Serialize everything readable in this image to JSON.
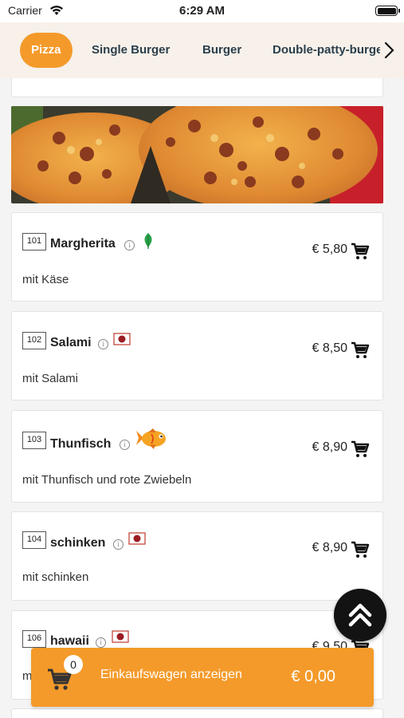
{
  "status_bar": {
    "carrier": "Carrier",
    "time": "6:29 AM"
  },
  "categories": [
    {
      "label": "Pizza",
      "active": true
    },
    {
      "label": "Single Burger",
      "active": false
    },
    {
      "label": "Burger",
      "active": false
    },
    {
      "label": "Double-patty-burger",
      "active": false
    }
  ],
  "menu_items": [
    {
      "number": "101",
      "name": "Margherita",
      "badge": "leaf-icon",
      "description": "mit Käse",
      "price": "€ 5,80"
    },
    {
      "number": "102",
      "name": "Salami",
      "badge": "meat-icon",
      "description": "mit Salami",
      "price": "€ 8,50"
    },
    {
      "number": "103",
      "name": "Thunfisch",
      "badge": "fish-icon",
      "description": "mit Thunfisch und rote Zwiebeln",
      "price": "€ 8,90"
    },
    {
      "number": "104",
      "name": "schinken",
      "badge": "meat-icon",
      "description": "mit schinken",
      "price": "€ 8,90"
    },
    {
      "number": "106",
      "name": "hawaii",
      "badge": "meat-icon",
      "description": "mit",
      "price": "€ 9,50"
    }
  ],
  "cart": {
    "count": "0",
    "label": "Einkaufswagen anzeigen",
    "total": "€ 0,00"
  },
  "colors": {
    "accent": "#f49a2a",
    "category_text": "#2b3f4c"
  }
}
